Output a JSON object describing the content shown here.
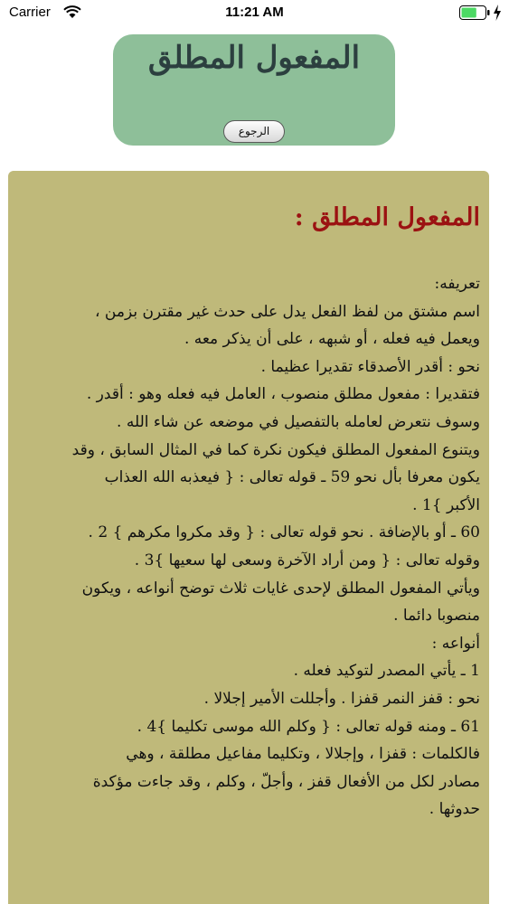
{
  "status_bar": {
    "carrier": "Carrier",
    "time": "11:21 AM",
    "battery_level": 0.65
  },
  "header": {
    "title": "المفعول المطلق",
    "back_label": "الرجوع"
  },
  "content": {
    "title": "المفعول المطلق :",
    "lines": [
      "تعريفه:",
      "اسم مشتق من لفظ الفعل يدل على حدث غير مقترن بزمن ،",
      "ويعمل فيه فعله ، أو شبهه ، على أن يذكر معه .",
      "نحو : أقدر الأصدقاء تقديرا عظيما .",
      "فتقديرا : مفعول مطلق منصوب ، العامل فيه فعله وهو : أقدر .",
      "وسوف نتعرض لعامله بالتفصيل في موضعه عن شاء الله .",
      "ويتنوع المفعول المطلق فيكون نكرة كما في المثال السابق ، وقد",
      "يكون معرفا بأل نحو 59 ـ قوله تعالى : { فيعذبه الله العذاب",
      "الأكبر }1 .",
      "60 ـ أو بالإضافة . نحو قوله تعالى : { وقد مكروا مكرهم } 2 .",
      "وقوله تعالى : { ومن أراد الآخرة وسعى لها سعيها }3 .",
      "ويأتي المفعول المطلق لإحدى غايات ثلاث توضح أنواعه ، ويكون",
      "منصوبا دائما .",
      "أنواعه :",
      "1 ـ يأتي المصدر لتوكيد فعله .",
      "نحو : قفز النمر قفزا . وأجللت الأمير إجلالا .",
      "61 ـ ومنه قوله تعالى : { وكلم الله موسى تكليما }4 .",
      "فالكلمات : قفزا ، وإجلالا ، وتكليما مفاعيل مطلقة ، وهي",
      "مصادر لكل من الأفعال قفز ، وأجلّ ، وكلم ، وقد جاءت مؤكدة",
      "حدوثها ."
    ]
  }
}
